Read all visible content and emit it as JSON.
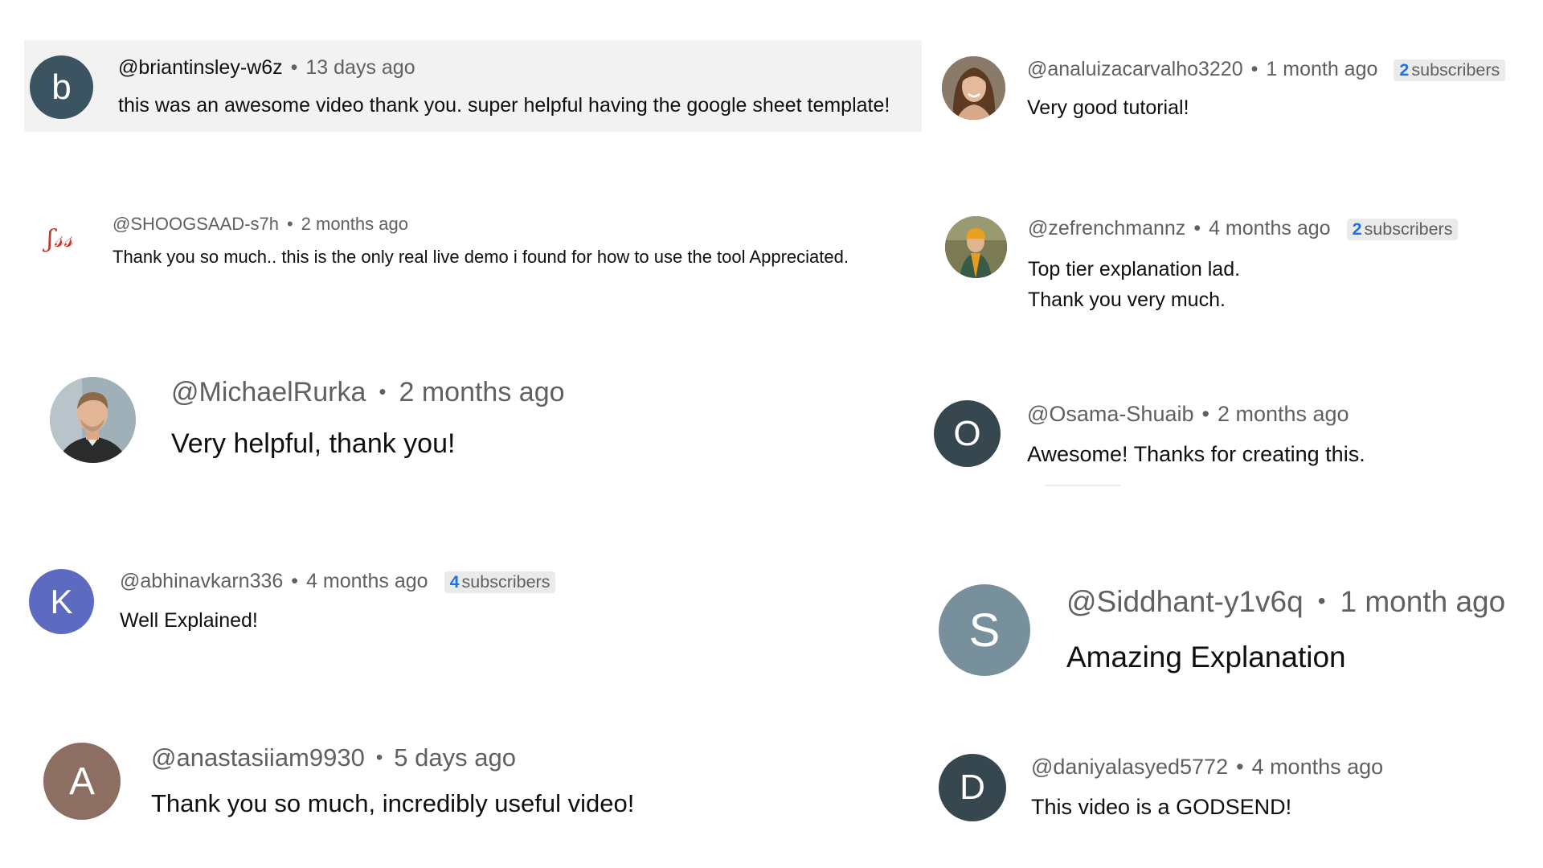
{
  "comments": [
    {
      "handle": "@briantinsley-w6z",
      "time": "13 days ago",
      "text": "this was an awesome video thank you. super helpful having the google sheet template!",
      "avatar_letter": "b",
      "avatar_color": "#3c5461"
    },
    {
      "handle": "@SHOOGSAAD-s7h",
      "time": "2 months ago",
      "text": "Thank you so much.. this is the only real live demo i found for how to use the tool Appreciated.",
      "avatar_logo": "ʃ𝓈𝓈",
      "avatar_color": "#c0392b"
    },
    {
      "handle": "@MichaelRurka",
      "time": "2 months ago",
      "text": "Very helpful, thank you!",
      "avatar_icon": "person-photo-icon"
    },
    {
      "handle": "@abhinavkarn336",
      "time": "4 months ago",
      "badge_num": "4",
      "badge_label": "subscribers",
      "text": "Well Explained!",
      "avatar_letter": "K",
      "avatar_color": "#5c6bc0"
    },
    {
      "handle": "@anastasiiam9930",
      "time": "5 days ago",
      "text": "Thank you so much, incredibly useful video!",
      "avatar_letter": "A",
      "avatar_color": "#8d6e63"
    },
    {
      "handle": "@analuizacarvalho3220",
      "time": "1 month ago",
      "badge_num": "2",
      "badge_label": "subscribers",
      "text": "Very good tutorial!",
      "avatar_icon": "person-photo-icon"
    },
    {
      "handle": "@zefrenchmannz",
      "time": "4 months ago",
      "badge_num": "2",
      "badge_label": "subscribers",
      "text_lines": [
        "Top tier explanation lad.",
        "Thank you very much."
      ],
      "avatar_icon": "person-photo-icon"
    },
    {
      "handle": "@Osama-Shuaib",
      "time": "2 months ago",
      "text": "Awesome! Thanks for creating this.",
      "avatar_letter": "O",
      "avatar_color": "#37474f"
    },
    {
      "handle": "@Siddhant-y1v6q",
      "time": "1 month ago",
      "text": "Amazing Explanation",
      "avatar_letter": "S",
      "avatar_color": "#78909c"
    },
    {
      "handle": "@daniyalasyed5772",
      "time": "4 months ago",
      "text": "This video is a GODSEND!",
      "avatar_letter": "D",
      "avatar_color": "#37474f"
    }
  ],
  "separator": "•"
}
